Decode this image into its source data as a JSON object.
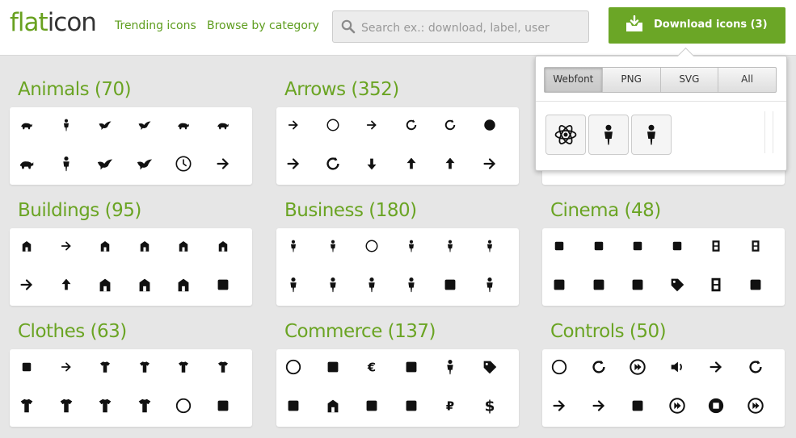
{
  "header": {
    "logo_flat": "flat",
    "logo_icon": "icon",
    "nav": [
      "Trending icons",
      "Browse by category"
    ],
    "search_placeholder": "Search ex.: download, label, user",
    "download_label": "Download icons (3)"
  },
  "colors": {
    "brand_green": "#6ba626",
    "title_green": "#6aa423",
    "background": "#e6e6e6"
  },
  "categories": [
    {
      "title": "Animals (70)",
      "icons": [
        "bull-icon",
        "man-icon",
        "bird-icon",
        "stork-icon",
        "fish-icon",
        "elephant-icon",
        "rabbit-icon",
        "runner-icon",
        "heron-icon",
        "flying-bird-icon",
        "clock-icon",
        "bone-icon"
      ]
    },
    {
      "title": "Arrows (352)",
      "icons": [
        "turn-right-arrow-icon",
        "circle-up-arrow-icon",
        "move-arrows-icon",
        "undo-arrow-icon",
        "refresh-arrows-icon",
        "circle-back-arrow-icon",
        "chevron-right-icon",
        "rotate-arrow-icon",
        "down-arrow-icon",
        "up-down-arrows-icon",
        "upload-arrow-icon",
        "diagonal-arrow-icon"
      ]
    },
    {
      "title": "Buildings (95)",
      "icons": [
        "house-icon",
        "escalator-icon",
        "pavilion-icon",
        "tower-gate-icon",
        "skyline-icon",
        "church-tower-icon",
        "stairs-icon",
        "roof-icon",
        "factory-icon",
        "home-icon",
        "chapel-icon",
        "office-building-icon"
      ]
    },
    {
      "title": "Business (180)",
      "icons": [
        "presenter-icon",
        "teacher-icon",
        "globe-icon",
        "worker-icon",
        "desk-worker-icon",
        "office-desk-icon",
        "handshake-icon",
        "two-people-icon",
        "thinking-man-icon",
        "team-icon",
        "clipboard-icon",
        "meeting-icon"
      ]
    },
    {
      "title": "Cinema (48)",
      "icons": [
        "projector-icon",
        "monitor-icon",
        "clapperboard-icon",
        "clapper-icon",
        "film-strip-icon",
        "video-play-icon",
        "movie-camera-icon",
        "theater-icon",
        "camera-tripod-icon",
        "ticket-icon",
        "film-reel-strip-icon",
        "camcorder-icon"
      ]
    },
    {
      "title": "Clothes (63)",
      "icons": [
        "laundry-icon",
        "pin-icon",
        "flip-flops-icon",
        "bra-icon",
        "sock-icon",
        "shoe-icon",
        "underwear-icon",
        "sweater-icon",
        "hanger-icon",
        "tshirt-icon",
        "cap-icon",
        "label-icon"
      ]
    },
    {
      "title": "Commerce (137)",
      "icons": [
        "ring-icon",
        "cash-register-icon",
        "euro-icon",
        "credit-card-icon",
        "shopper-icon",
        "price-tag-icon",
        "shopping-bag-icon",
        "shop-icon",
        "glass-icon",
        "basket-icon",
        "ruble-icon",
        "dollar-icon"
      ]
    },
    {
      "title": "Controls (50)",
      "icons": [
        "brightness-icon",
        "reload-icon",
        "fast-forward-icon",
        "volume-icon",
        "collapse-icon",
        "refresh-icon",
        "expand-icon",
        "compress-icon",
        "microphone-icon",
        "skip-forward-icon",
        "stop-icon",
        "skip-back-icon"
      ]
    }
  ],
  "popup": {
    "formats": [
      "Webfont",
      "PNG",
      "SVG",
      "All"
    ],
    "selected_icons": [
      "atom-icon",
      "teacher-icon",
      "desk-worker-icon"
    ]
  }
}
